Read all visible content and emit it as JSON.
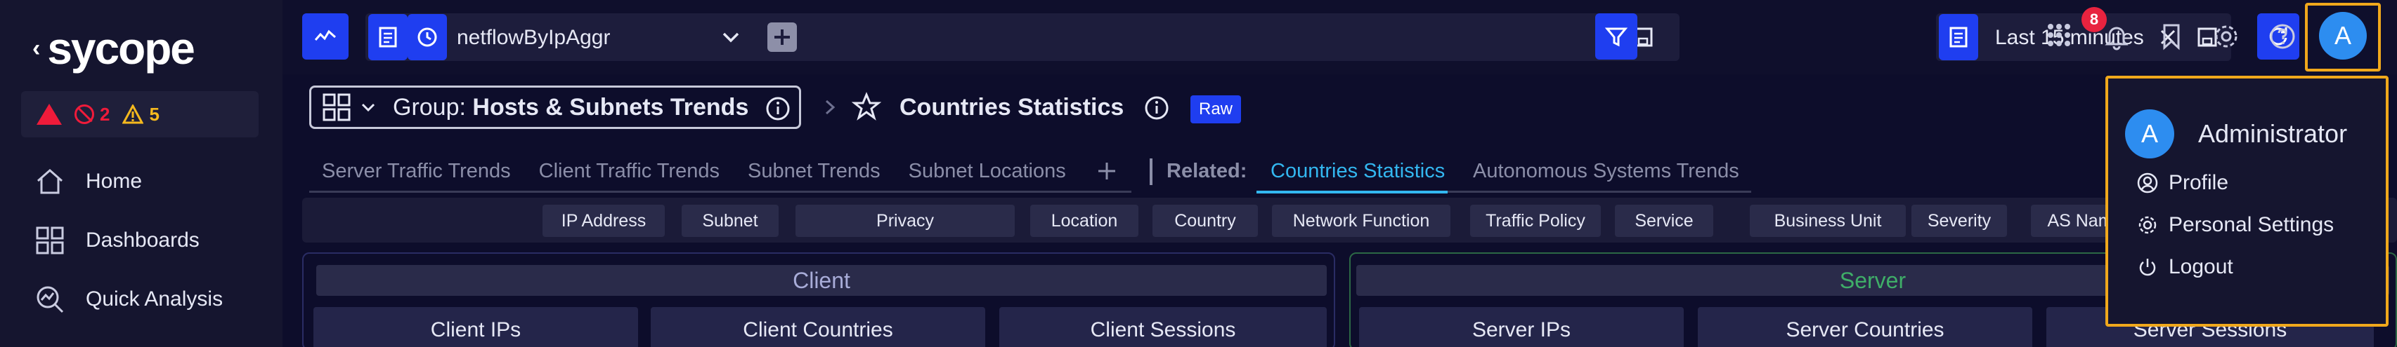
{
  "brand": {
    "logo_text": "sycope"
  },
  "alerts": {
    "errors": "2",
    "warnings": "5"
  },
  "nav": {
    "items": [
      {
        "label": "Home"
      },
      {
        "label": "Dashboards"
      },
      {
        "label": "Quick Analysis"
      }
    ]
  },
  "topbar": {
    "view_name": "netflowByIpAggr",
    "time_range": "Last 15 minutes",
    "notification_count": "8",
    "avatar_letter": "A"
  },
  "group": {
    "prefix": "Group: ",
    "name": "Hosts & Subnets Trends"
  },
  "page": {
    "title": "Countries Statistics",
    "badge": "Raw"
  },
  "tabs": [
    "Server Traffic Trends",
    "Client Traffic Trends",
    "Subnet Trends",
    "Subnet Locations"
  ],
  "related": {
    "label": "Related:",
    "tabs": [
      {
        "label": "Countries Statistics",
        "active": true
      },
      {
        "label": "Autonomous Systems Trends",
        "active": false
      }
    ]
  },
  "filters": [
    "IP Address",
    "Subnet",
    "Privacy",
    "Location",
    "Country",
    "Network Function",
    "Traffic Policy",
    "Service",
    "Business Unit",
    "Severity",
    "AS Nam"
  ],
  "panels": {
    "client": {
      "title": "Client",
      "subs": [
        "Client IPs",
        "Client Countries",
        "Client Sessions"
      ]
    },
    "server": {
      "title": "Server",
      "subs": [
        "Server IPs",
        "Server Countries",
        "Server Sessions"
      ]
    }
  },
  "user_menu": {
    "avatar_letter": "A",
    "user_name": "Administrator",
    "items": [
      {
        "label": "Profile"
      },
      {
        "label": "Personal Settings"
      },
      {
        "label": "Logout"
      }
    ]
  },
  "colors": {
    "accent": "#1f3ef0",
    "highlight": "#f0a81c",
    "active_tab": "#33b7f0",
    "error": "#ef1b3a",
    "warning": "#f5b91e"
  }
}
